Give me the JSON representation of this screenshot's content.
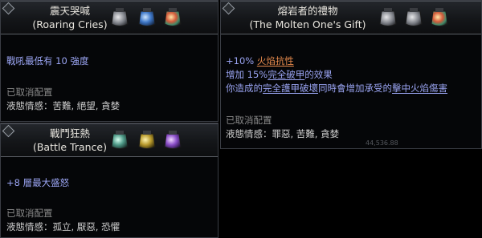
{
  "roaring": {
    "name_cn": "震天哭喊",
    "name_en": "(Roaring Cries)",
    "effect": {
      "text": "戰吼最低有 10 強度"
    },
    "status": "已取消配置",
    "flavor": "液態情感：苦難, 絕望, 貪婪"
  },
  "trance": {
    "name_cn": "戰鬥狂熱",
    "name_en": "(Battle Trance)",
    "effect": {
      "text": "+8 層最大盛怒"
    },
    "status": "已取消配置",
    "flavor": "液態情感：孤立, 厭惡, 恐懼"
  },
  "molten": {
    "name_cn": "熔岩者的禮物",
    "name_en": "(The Molten One's Gift)",
    "line1": {
      "prefix": "+10% ",
      "kw": "火焰抗性"
    },
    "line2": {
      "a": "增加 15%",
      "kw": "完全破甲",
      "b": "的效果"
    },
    "line3": {
      "a": "你造成的",
      "kw1": "完全護甲破壞",
      "b": "同時會增加承受的",
      "kw2": "擊中火焰傷害"
    },
    "status": "已取消配置",
    "flavor": "液態情感：罪惡, 苦難, 貪婪",
    "bg_number": "44,536.88"
  },
  "colors": {
    "effect_blue": "#9aa4f2",
    "fire_orange": "#e58a4d",
    "status_gray": "#8a8a8a"
  },
  "icons": [
    "oil-icon-silver",
    "oil-icon-azure",
    "oil-icon-opal",
    "oil-icon-teal",
    "oil-icon-amber",
    "oil-icon-violet"
  ]
}
